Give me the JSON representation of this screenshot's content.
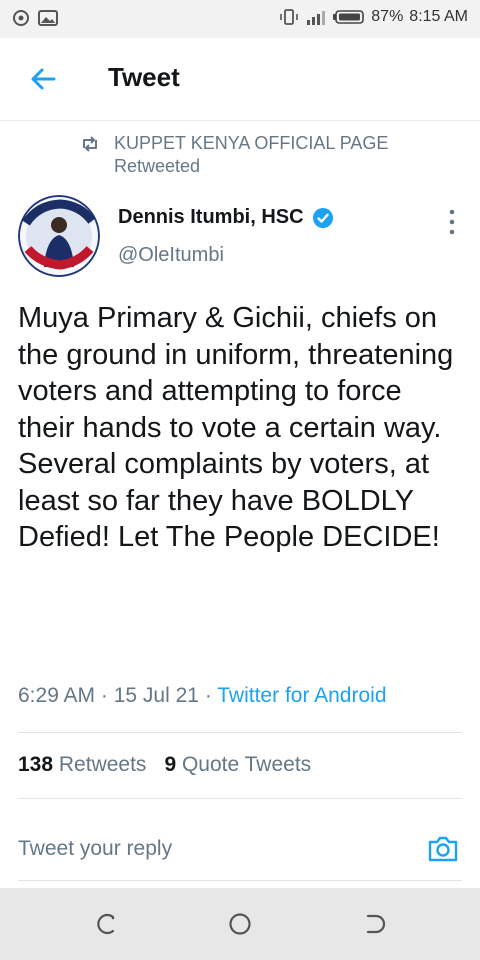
{
  "status_bar": {
    "battery": "87%",
    "time": "8:15 AM"
  },
  "header": {
    "title": "Tweet"
  },
  "retweet_context": {
    "account": "KUPPET KENYA OFFICIAL PAGE",
    "label": "Retweeted"
  },
  "author": {
    "display_name": "Dennis Itumbi, HSC",
    "handle": "@OleItumbi",
    "verified": true
  },
  "tweet": {
    "text": "Muya Primary & Gichii, chiefs on the ground in uniform, threatening voters and attempting to force their hands to vote a certain way. Several complaints by voters, at least so far they have BOLDLY Defied! Let The People DECIDE!",
    "time": "6:29 AM",
    "date": "15 Jul 21",
    "source": "Twitter for Android"
  },
  "stats": {
    "retweets_count": "138",
    "retweets_label": "Retweets",
    "quotes_count": "9",
    "quotes_label": "Quote Tweets"
  },
  "reply": {
    "placeholder": "Tweet your reply"
  },
  "colors": {
    "accent": "#1da1f2",
    "secondary_text": "#657786",
    "primary_text": "#14171a"
  }
}
